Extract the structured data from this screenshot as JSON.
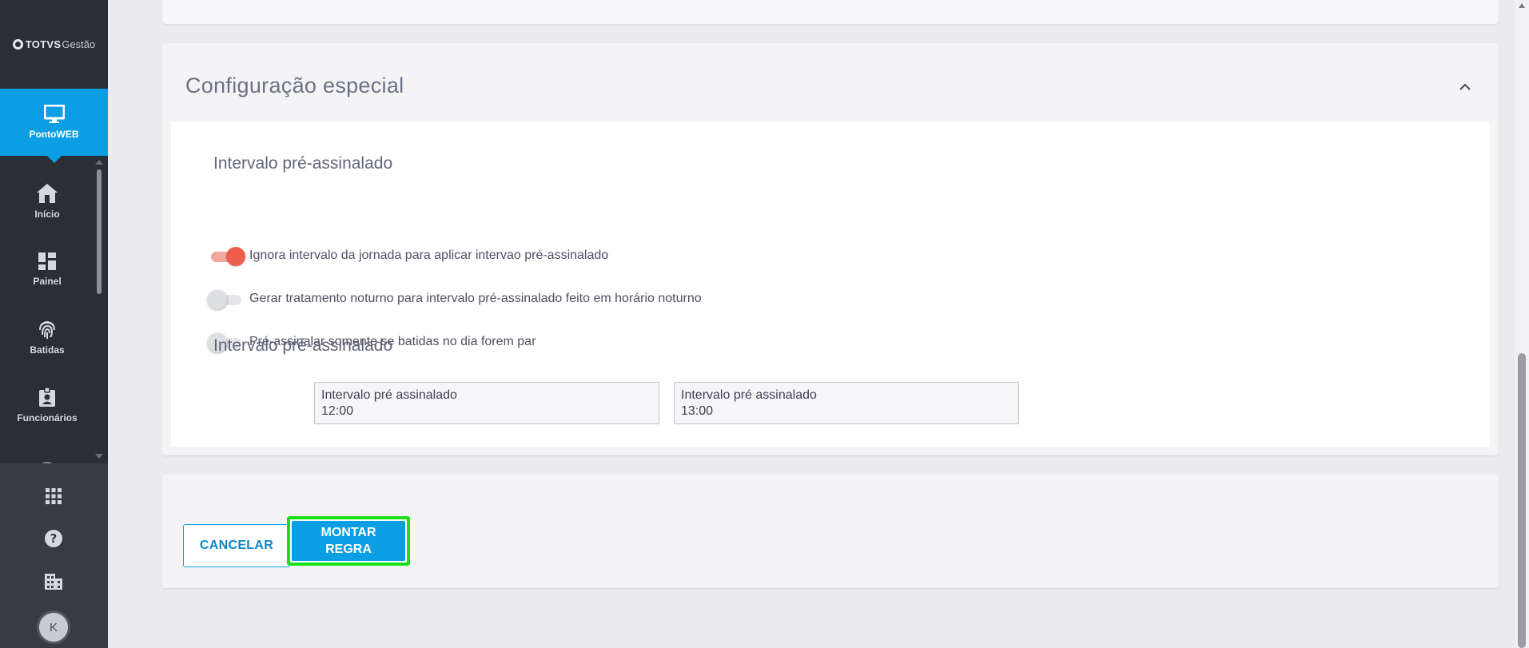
{
  "app": {
    "logo_brand": "TOTVS",
    "logo_suffix": "Gestão"
  },
  "sidebar": {
    "active": {
      "label": "PontoWEB",
      "icon": "monitor-icon"
    },
    "items": [
      {
        "label": "Início",
        "icon": "home-icon"
      },
      {
        "label": "Painel",
        "icon": "dashboard-icon"
      },
      {
        "label": "Batidas",
        "icon": "fingerprint-icon"
      },
      {
        "label": "Funcionários",
        "icon": "badge-icon"
      },
      {
        "label": "",
        "icon": "clock-icon"
      }
    ],
    "bottom": [
      {
        "icon": "apps-grid-icon"
      },
      {
        "icon": "help-icon"
      },
      {
        "icon": "building-icon"
      }
    ],
    "avatar_initial": "K"
  },
  "section": {
    "title": "Configuração especial",
    "subsections": [
      {
        "title": "Intervalo pré-assinalado"
      },
      {
        "title": "Intervalo pré-assinalado"
      }
    ],
    "toggles": [
      {
        "label": "Ignora intervalo da jornada para aplicar intervao pré-assinalado",
        "on": true
      },
      {
        "label": "Gerar tratamento noturno para intervalo pré-assinalado feito em horário noturno",
        "on": false
      },
      {
        "label": "Pré-assinalar somente se batidas no dia forem par",
        "on": false
      }
    ],
    "fields": [
      {
        "label": "Intervalo pré assinalado",
        "value": "12:00"
      },
      {
        "label": "Intervalo pré assinalado",
        "value": "13:00"
      }
    ]
  },
  "footer": {
    "cancel_label": "CANCELAR",
    "submit_line1": "MONTAR",
    "submit_line2": "REGRA"
  },
  "colors": {
    "accent": "#0c9ee3",
    "toggle_on": "#ee5e4a",
    "highlight": "#19e01b",
    "sidebar_bg": "#2c2e36"
  }
}
